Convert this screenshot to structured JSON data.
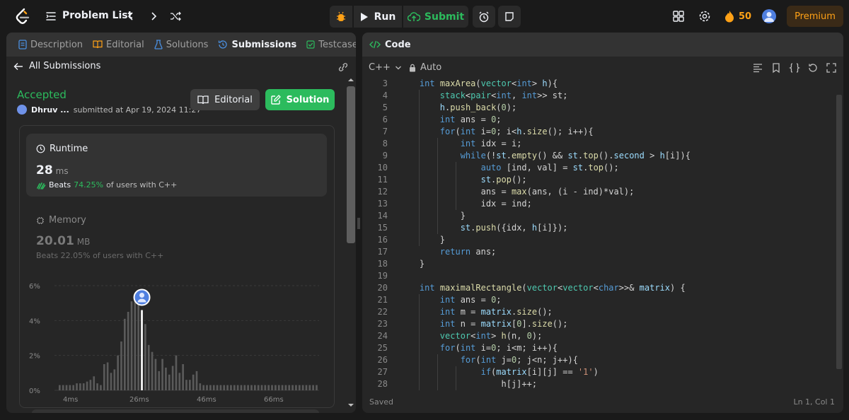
{
  "topbar": {
    "problem_list": "Problem List",
    "run": "Run",
    "submit": "Submit",
    "streak": "50",
    "premium": "Premium"
  },
  "left_panel": {
    "tabs": [
      {
        "label": "Description",
        "icon": "description-icon"
      },
      {
        "label": "Editorial",
        "icon": "book-icon"
      },
      {
        "label": "Solutions",
        "icon": "flask-icon"
      },
      {
        "label": "Submissions",
        "icon": "history-icon"
      },
      {
        "label": "Testcase",
        "icon": "check-box-icon"
      }
    ],
    "back_label": "All Submissions",
    "status": "Accepted",
    "user": "Dhruv ...",
    "submitted": "submitted at Apr 19, 2024 11:27",
    "editorial_btn": "Editorial",
    "solution_btn": "Solution",
    "runtime": {
      "label": "Runtime",
      "value": "28",
      "unit": "ms",
      "beats_word": "Beats",
      "beats_pct": "74.25%",
      "beats_suffix": "of users with C++"
    },
    "memory": {
      "label": "Memory",
      "value": "20.01",
      "unit": "MB",
      "beats_word": "Beats",
      "beats_pct": "22.05%",
      "beats_suffix": "of users with C++"
    }
  },
  "chart_data": {
    "type": "bar",
    "ylim": [
      0,
      6
    ],
    "yticks": [
      "6%",
      "4%",
      "2%",
      "0%"
    ],
    "xticks": [
      "4ms",
      "26ms",
      "46ms",
      "66ms"
    ],
    "highlight_category": "28ms",
    "values": [
      0.3,
      0.3,
      0.3,
      0.3,
      0.3,
      0.4,
      0.4,
      0.4,
      0.5,
      0.6,
      0.8,
      0.4,
      0.3,
      1.5,
      1.6,
      1.0,
      1.2,
      2.0,
      2.8,
      4.1,
      4.5,
      5.1,
      5.5,
      5.2,
      4.6,
      3.8,
      2.6,
      2.2,
      1.8,
      1.1,
      1.8,
      1.3,
      0.9,
      1.4,
      2.0,
      1.0,
      1.5,
      0.6,
      0.6,
      0.9,
      1.1,
      0.4,
      0.3,
      0.3,
      0.3,
      0.3,
      0.3,
      0.3,
      0.3,
      0.3,
      0.3,
      0.3,
      0.3,
      0.3,
      0.3,
      0.3,
      0.3,
      0.3,
      0.3,
      0.3,
      0.3,
      0.3,
      0.3,
      0.3,
      0.3,
      0.3,
      0.3,
      0.3,
      0.3,
      0.3,
      0.3,
      0.3,
      0.3,
      0.3,
      0.3,
      0.3
    ]
  },
  "code_panel": {
    "title": "Code",
    "language": "C++",
    "mode": "Auto",
    "saved": "Saved",
    "position": "Ln 1, Col 1",
    "lines": [
      {
        "n": "3",
        "html": "    <span class='kw'>int</span> <span class='fn'>maxArea</span>(<span class='ty'>vector</span>&lt;<span class='kw'>int</span>&gt; <span class='vr'>h</span>){"
      },
      {
        "n": "4",
        "html": "        <span class='ty'>stack</span>&lt;<span class='ty'>pair</span>&lt;<span class='kw'>int</span>, <span class='kw'>int</span>&gt;&gt; st;"
      },
      {
        "n": "5",
        "html": "        <span class='vr'>h</span>.<span class='fn'>push_back</span>(<span class='num'>0</span>);"
      },
      {
        "n": "6",
        "html": "        <span class='kw'>int</span> ans = <span class='num'>0</span>;"
      },
      {
        "n": "7",
        "html": "        <span class='kw'>for</span>(<span class='kw'>int</span> i=<span class='num'>0</span>; i&lt;<span class='vr'>h</span>.<span class='fn'>size</span>(); i++){"
      },
      {
        "n": "8",
        "html": "            <span class='kw'>int</span> idx = i;"
      },
      {
        "n": "9",
        "html": "            <span class='kw'>while</span>(!<span class='vr'>st</span>.<span class='fn'>empty</span>() &amp;&amp; <span class='vr'>st</span>.<span class='fn'>top</span>().<span class='vr'>second</span> &gt; <span class='vr'>h</span>[i]){"
      },
      {
        "n": "10",
        "html": "                <span class='kw'>auto</span> [ind, val] = <span class='vr'>st</span>.<span class='fn'>top</span>();"
      },
      {
        "n": "11",
        "html": "                <span class='vr'>st</span>.<span class='fn'>pop</span>();"
      },
      {
        "n": "12",
        "html": "                ans = <span class='fn'>max</span>(ans, (i - ind)*val);"
      },
      {
        "n": "13",
        "html": "                idx = ind;"
      },
      {
        "n": "14",
        "html": "            }"
      },
      {
        "n": "15",
        "html": "            <span class='vr'>st</span>.<span class='fn'>push</span>({idx, <span class='vr'>h</span>[i]});"
      },
      {
        "n": "16",
        "html": "        }"
      },
      {
        "n": "17",
        "html": "        <span class='kw'>return</span> ans;"
      },
      {
        "n": "18",
        "html": "    }"
      },
      {
        "n": "19",
        "html": ""
      },
      {
        "n": "20",
        "html": "    <span class='kw'>int</span> <span class='fn'>maximalRectangle</span>(<span class='ty'>vector</span>&lt;<span class='ty'>vector</span>&lt;<span class='kw'>char</span>&gt;&gt;&amp; <span class='vr'>matrix</span>) {"
      },
      {
        "n": "21",
        "html": "        <span class='kw'>int</span> ans = <span class='num'>0</span>;"
      },
      {
        "n": "22",
        "html": "        <span class='kw'>int</span> m = <span class='vr'>matrix</span>.<span class='fn'>size</span>();"
      },
      {
        "n": "23",
        "html": "        <span class='kw'>int</span> n = <span class='vr'>matrix</span>[<span class='num'>0</span>].<span class='fn'>size</span>();"
      },
      {
        "n": "24",
        "html": "        <span class='ty'>vector</span>&lt;<span class='kw'>int</span>&gt; <span class='fn'>h</span>(n, <span class='num'>0</span>);"
      },
      {
        "n": "25",
        "html": "        <span class='kw'>for</span>(<span class='kw'>int</span> i=<span class='num'>0</span>; i&lt;m; i++){"
      },
      {
        "n": "26",
        "html": "            <span class='kw'>for</span>(<span class='kw'>int</span> j=<span class='num'>0</span>; j&lt;n; j++){"
      },
      {
        "n": "27",
        "html": "                <span class='kw'>if</span>(<span class='vr'>matrix</span>[i][j] == <span class='str'>'1'</span>)"
      },
      {
        "n": "28",
        "html": "                    h[j]++;"
      }
    ]
  }
}
